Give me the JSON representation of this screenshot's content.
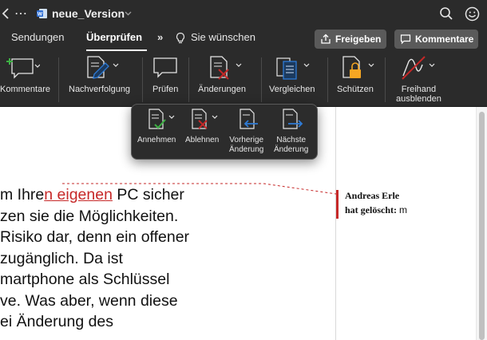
{
  "window": {
    "title": "neue_Version",
    "more_glyph": "⋯"
  },
  "tabs": {
    "items": [
      {
        "label": "Sendungen"
      },
      {
        "label": "Überprüfen",
        "active": true
      }
    ],
    "overflow": "»",
    "tell_me": "Sie wünschen",
    "share_label": "Freigeben",
    "comments_label": "Kommentare"
  },
  "ribbon": {
    "kommentare": "Kommentare",
    "nachverfolgung": "Nachverfolgung",
    "pruefen": "Prüfen",
    "aenderungen": "Änderungen",
    "vergleichen": "Vergleichen",
    "schuetzen": "Schützen",
    "freihand": [
      "Freihand",
      "ausblenden"
    ]
  },
  "popup": {
    "annehmen": "Annehmen",
    "ablehnen": "Ablehnen",
    "vorherige": [
      "Vorherige",
      "Änderung"
    ],
    "naechste": [
      "Nächste",
      "Änderung"
    ]
  },
  "document": {
    "lines": [
      {
        "pre": "m Ihre",
        "ins": "n eigenen",
        "post": " PC sicher"
      },
      {
        "text": "zen sie die Möglichkeiten."
      },
      {
        "text": " Risiko dar, denn ein offener"
      },
      {
        "text": " zugänglich. Da ist"
      },
      {
        "text": "martphone als Schlüssel"
      },
      {
        "text": "ve. Was aber, wenn diese"
      },
      {
        "text": "ei Änderung des"
      }
    ]
  },
  "comment": {
    "author": "Andreas Erle",
    "action": "hat gelöscht:",
    "deleted_text": "m"
  },
  "colors": {
    "chrome": "#2b2b2b",
    "accent_red": "#c62828",
    "accent_blue": "#2e7bd6",
    "accent_green": "#3cb043",
    "accent_orange": "#f5a623"
  }
}
